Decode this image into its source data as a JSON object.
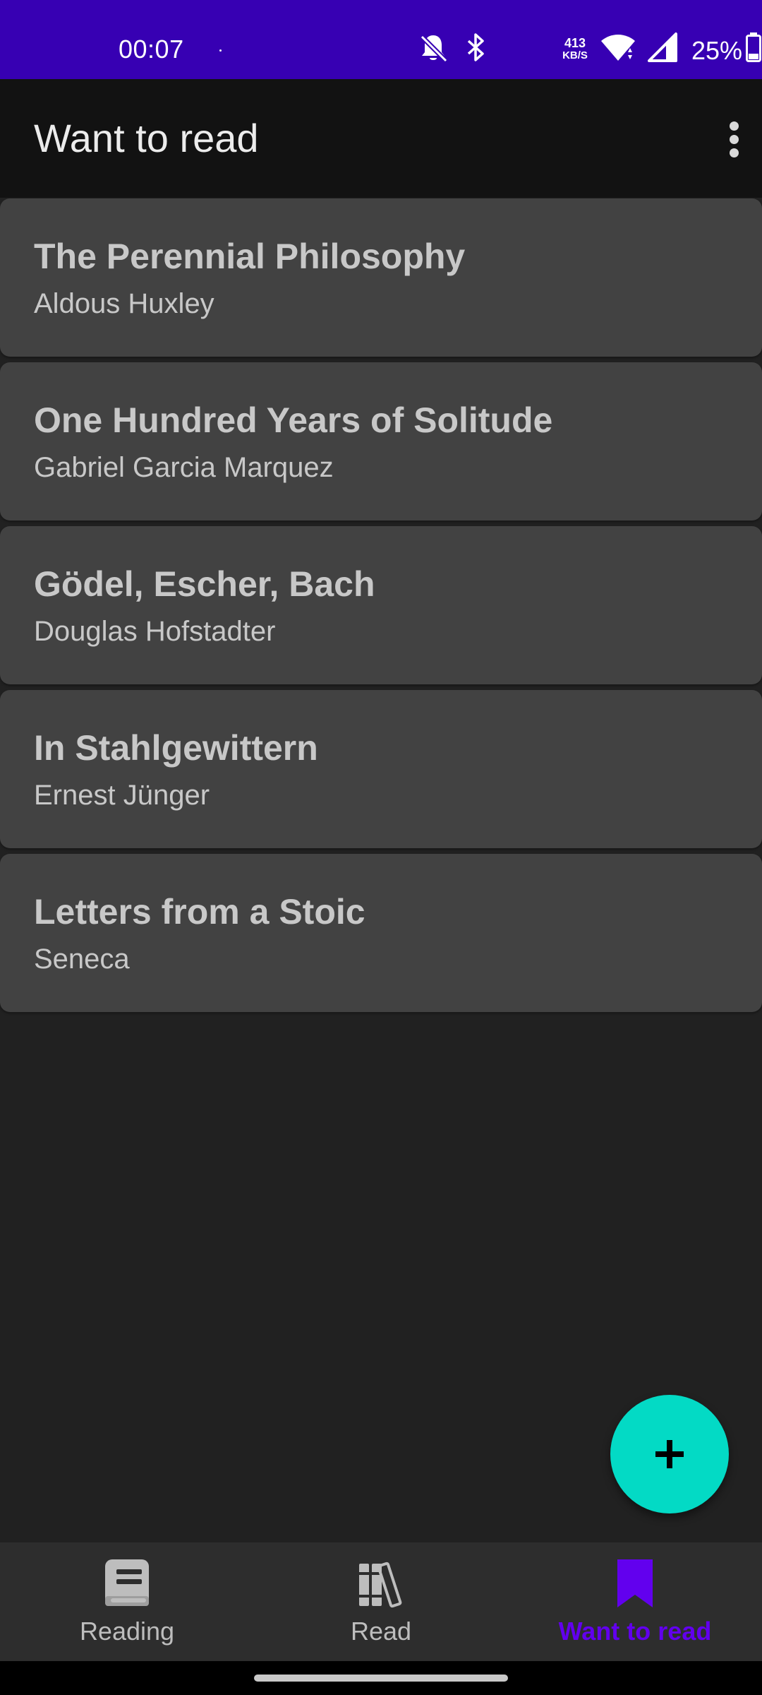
{
  "status_bar": {
    "time": "00:07",
    "net_speed_value": "413",
    "net_speed_unit": "KB/S",
    "battery_percent": "25%"
  },
  "app_bar": {
    "title": "Want to read",
    "menu_icon": "more-vert-icon"
  },
  "books": [
    {
      "title": "The Perennial Philosophy",
      "author": "Aldous Huxley"
    },
    {
      "title": "One Hundred Years of Solitude",
      "author": "Gabriel Garcia Marquez"
    },
    {
      "title": "Gödel, Escher, Bach",
      "author": "Douglas Hofstadter"
    },
    {
      "title": "In Stahlgewittern",
      "author": "Ernest Jünger"
    },
    {
      "title": "Letters from a Stoic",
      "author": "Seneca"
    }
  ],
  "fab": {
    "icon": "plus-icon"
  },
  "bottom_nav": {
    "items": [
      {
        "label": "Reading",
        "icon": "book-icon",
        "active": false
      },
      {
        "label": "Read",
        "icon": "bookshelf-icon",
        "active": false
      },
      {
        "label": "Want to read",
        "icon": "bookmark-icon",
        "active": true
      }
    ]
  },
  "colors": {
    "status_bar": "#3700b3",
    "app_bar": "#121212",
    "background": "#212121",
    "card": "#424242",
    "fab": "#03dac5",
    "nav_active": "#6200ee",
    "nav_inactive": "#bdbdbd"
  }
}
